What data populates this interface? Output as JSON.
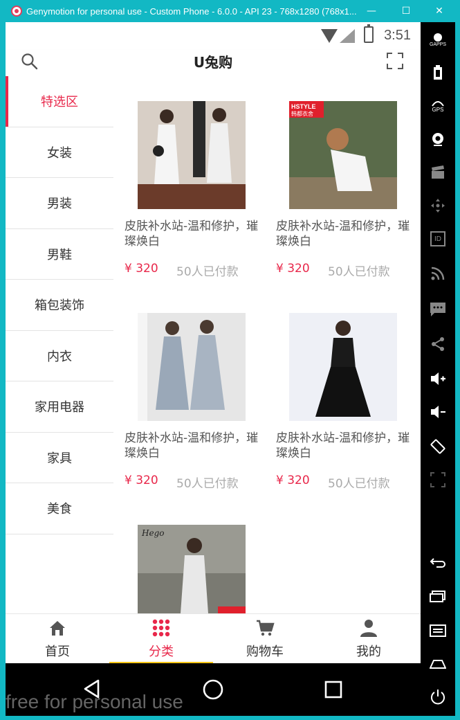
{
  "window": {
    "title": "Genymotion for personal use - Custom Phone - 6.0.0 - API 23 - 768x1280 (768x1...",
    "minimize": "—",
    "maximize": "☐",
    "close": "✕",
    "watermark": "free for personal use"
  },
  "statusbar": {
    "time": "3:51"
  },
  "appbar": {
    "title": "U兔购"
  },
  "sidebar": {
    "items": [
      {
        "label": "特选区"
      },
      {
        "label": "女装"
      },
      {
        "label": "男装"
      },
      {
        "label": "男鞋"
      },
      {
        "label": "箱包装饰"
      },
      {
        "label": "内衣"
      },
      {
        "label": "家用电器"
      },
      {
        "label": "家具"
      },
      {
        "label": "美食"
      }
    ]
  },
  "products": [
    {
      "name": "皮肤补水站-温和修护，璀璨焕白",
      "price": "¥ 320",
      "sold": "50人已付款"
    },
    {
      "name": "皮肤补水站-温和修护，璀璨焕白",
      "price": "¥ 320",
      "sold": "50人已付款",
      "tag": "HSTYLE 韩都衣舍"
    },
    {
      "name": "皮肤补水站-温和修护，璀璨焕白",
      "price": "¥ 320",
      "sold": "50人已付款"
    },
    {
      "name": "皮肤补水站-温和修护，璀璨焕白",
      "price": "¥ 320",
      "sold": "50人已付款"
    },
    {
      "name": "",
      "price": "",
      "sold": "",
      "tag": "Hego"
    }
  ],
  "bottomnav": {
    "items": [
      {
        "label": "首页",
        "icon": "home-icon"
      },
      {
        "label": "分类",
        "icon": "grid-dots-icon"
      },
      {
        "label": "购物车",
        "icon": "cart-icon"
      },
      {
        "label": "我的",
        "icon": "user-icon"
      }
    ]
  },
  "toolbar": {
    "gapps": "GAPPS",
    "gps": "GPS",
    "id": "ID"
  },
  "colors": {
    "accent": "#e8274a",
    "indicator": "#f6c616",
    "frame": "#12b8c4"
  }
}
